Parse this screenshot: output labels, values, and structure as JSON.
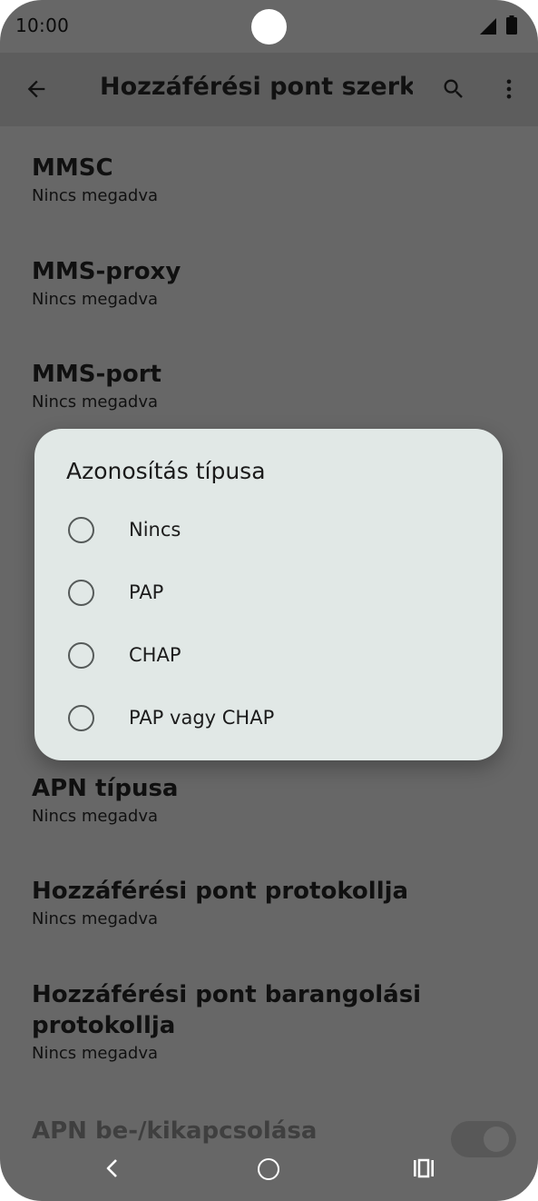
{
  "status_bar": {
    "time": "10:00"
  },
  "app_bar": {
    "title": "Hozzáférési pont szerk..."
  },
  "settings": [
    {
      "title": "MMSC",
      "summary": "Nincs megadva"
    },
    {
      "title": "MMS-proxy",
      "summary": "Nincs megadva"
    },
    {
      "title": "MMS-port",
      "summary": "Nincs megadva"
    },
    {
      "title": "APN típusa",
      "summary": "Nincs megadva"
    },
    {
      "title": "Hozzáférési pont protokollja",
      "summary": "Nincs megadva"
    },
    {
      "title_line1": "Hozzáférési pont barangolási",
      "title_line2": "protokollja",
      "summary": "Nincs megadva"
    },
    {
      "title": "APN be-/kikapcsolása",
      "summary": ""
    }
  ],
  "dialog": {
    "title": "Azonosítás típusa",
    "options": [
      {
        "label": "Nincs"
      },
      {
        "label": "PAP"
      },
      {
        "label": "CHAP"
      },
      {
        "label": "PAP vagy CHAP"
      }
    ]
  },
  "icons": {
    "back": "arrow-left-icon",
    "search": "search-icon",
    "more": "more-vert-icon",
    "nav_back": "chevron-left-icon",
    "nav_home": "circle-icon",
    "nav_recents": "recents-icon"
  },
  "colors": {
    "scrim_background": "#676767",
    "app_bar": "#5d5d5d",
    "dialog_surface": "#e1e8e6"
  }
}
